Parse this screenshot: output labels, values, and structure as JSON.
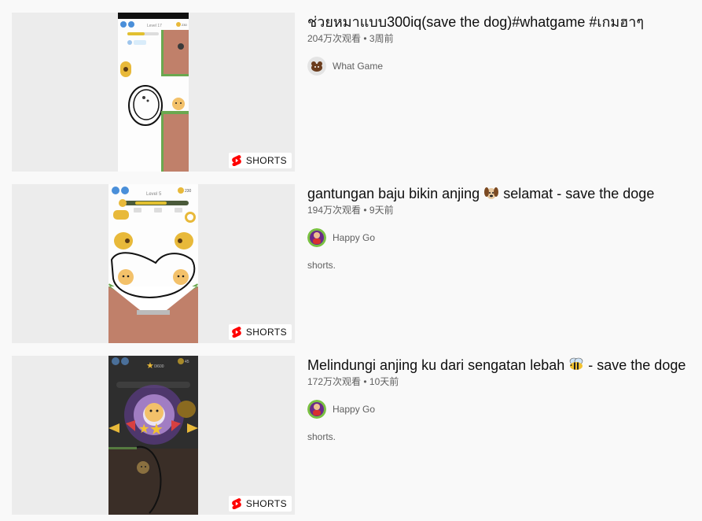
{
  "shorts_label": "SHORTS",
  "results": [
    {
      "title": "ช่วยหมาแบบ300iq(save the dog)#whatgame #เกมฮาๆ",
      "views": "204万次观看",
      "separator": "•",
      "age": "3周前",
      "channel": "What Game",
      "description": ""
    },
    {
      "title_before": "gantungan baju bikin anjing",
      "title_emoji": "dog-face-icon",
      "title_after": "selamat - save the doge",
      "views": "194万次观看",
      "separator": "•",
      "age": "9天前",
      "channel": "Happy Go",
      "description": "shorts."
    },
    {
      "title_before": "Melindungi anjing ku dari sengatan lebah",
      "title_emoji": "bee-icon",
      "title_after": "- save the doge",
      "views": "172万次观看",
      "separator": "•",
      "age": "10天前",
      "channel": "Happy Go",
      "description": "shorts."
    }
  ],
  "game1": {
    "level": "Level 17",
    "coins": "230"
  },
  "game2": {
    "level": "Level 5",
    "coins": "230"
  },
  "game3": {
    "score": "0/600",
    "coins": "45"
  },
  "colors": {
    "shorts_red": "#ff0000",
    "meta_gray": "#606060",
    "grass": "#6aa84f",
    "dirt": "#c0806a"
  }
}
